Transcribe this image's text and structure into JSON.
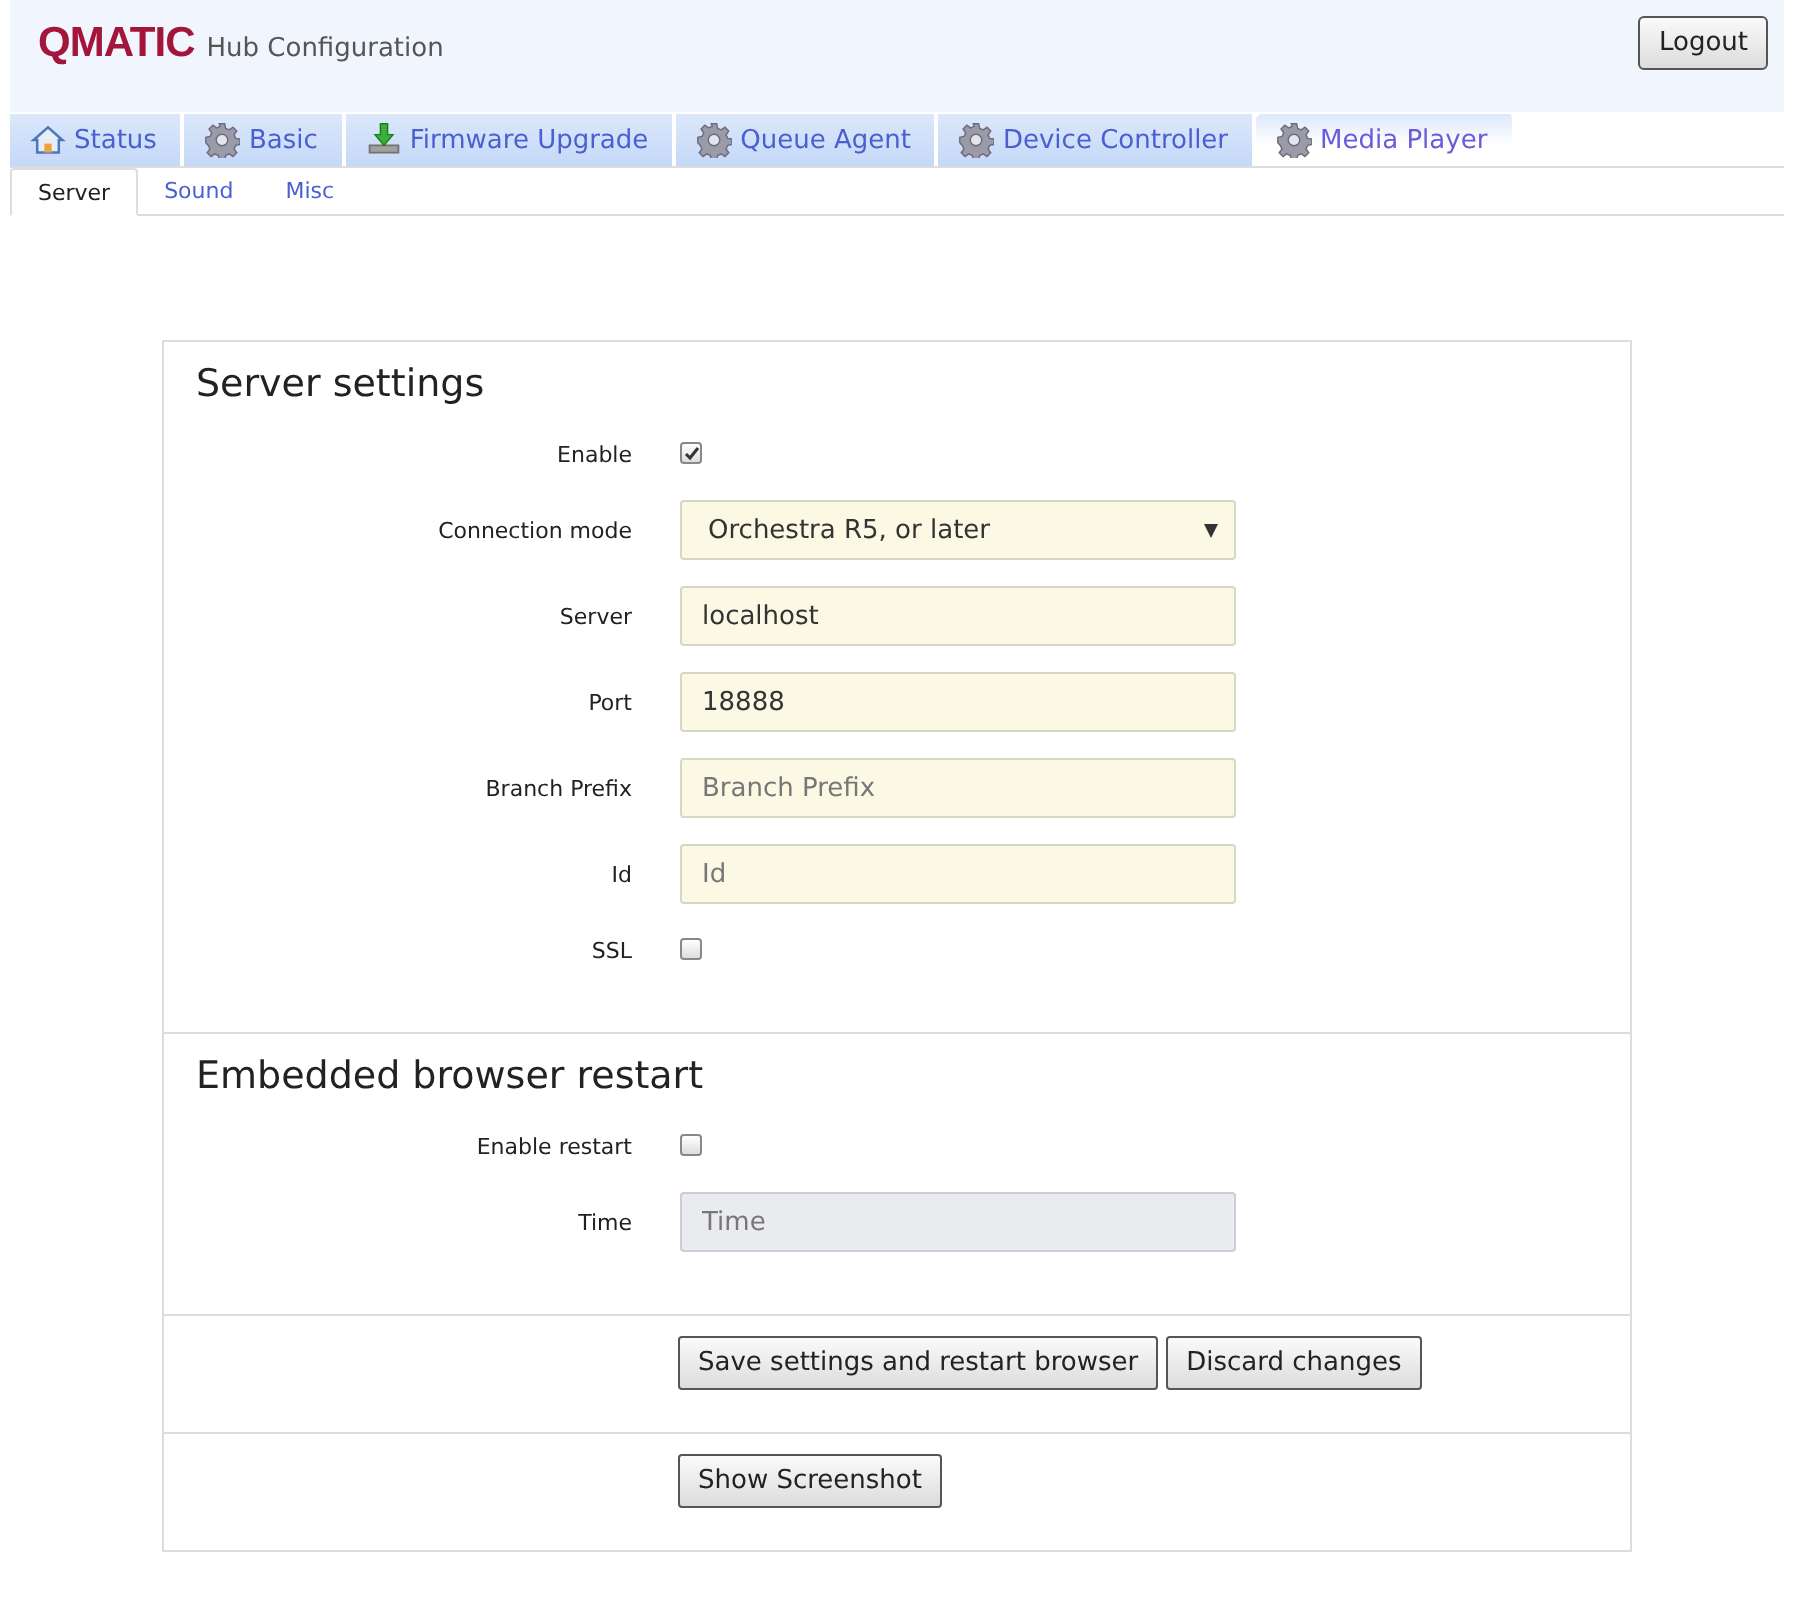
{
  "header": {
    "logo": "QMATIC",
    "title": "Hub Configuration",
    "logout": "Logout"
  },
  "tabs": [
    {
      "label": "Status",
      "selected": false
    },
    {
      "label": "Basic",
      "selected": false
    },
    {
      "label": "Firmware Upgrade",
      "selected": false
    },
    {
      "label": "Queue Agent",
      "selected": false
    },
    {
      "label": "Device Controller",
      "selected": false
    },
    {
      "label": "Media Player",
      "selected": true
    }
  ],
  "subtabs": [
    {
      "label": "Server",
      "selected": true
    },
    {
      "label": "Sound",
      "selected": false
    },
    {
      "label": "Misc",
      "selected": false
    }
  ],
  "sections": [
    {
      "title": "Server settings",
      "fields": [
        {
          "kind": "checkbox",
          "label": "Enable",
          "checked": true
        },
        {
          "kind": "select",
          "label": "Connection mode",
          "value": "Orchestra R5, or later"
        },
        {
          "kind": "text",
          "label": "Server",
          "value": "localhost",
          "disabled": false
        },
        {
          "kind": "text",
          "label": "Port",
          "value": "18888",
          "disabled": false
        },
        {
          "kind": "text",
          "label": "Branch Prefix",
          "placeholder": "Branch Prefix",
          "disabled": false
        },
        {
          "kind": "text",
          "label": "Id",
          "placeholder": "Id",
          "disabled": false
        },
        {
          "kind": "checkbox",
          "label": "SSL",
          "checked": false
        }
      ]
    },
    {
      "title": "Embedded browser restart",
      "fields": [
        {
          "kind": "checkbox",
          "label": "Enable restart",
          "checked": false
        },
        {
          "kind": "text",
          "label": "Time",
          "placeholder": "Time",
          "disabled": true
        }
      ]
    }
  ],
  "actions": [
    [
      "Save settings and restart browser",
      "Discard changes"
    ],
    [
      "Show Screenshot"
    ]
  ]
}
